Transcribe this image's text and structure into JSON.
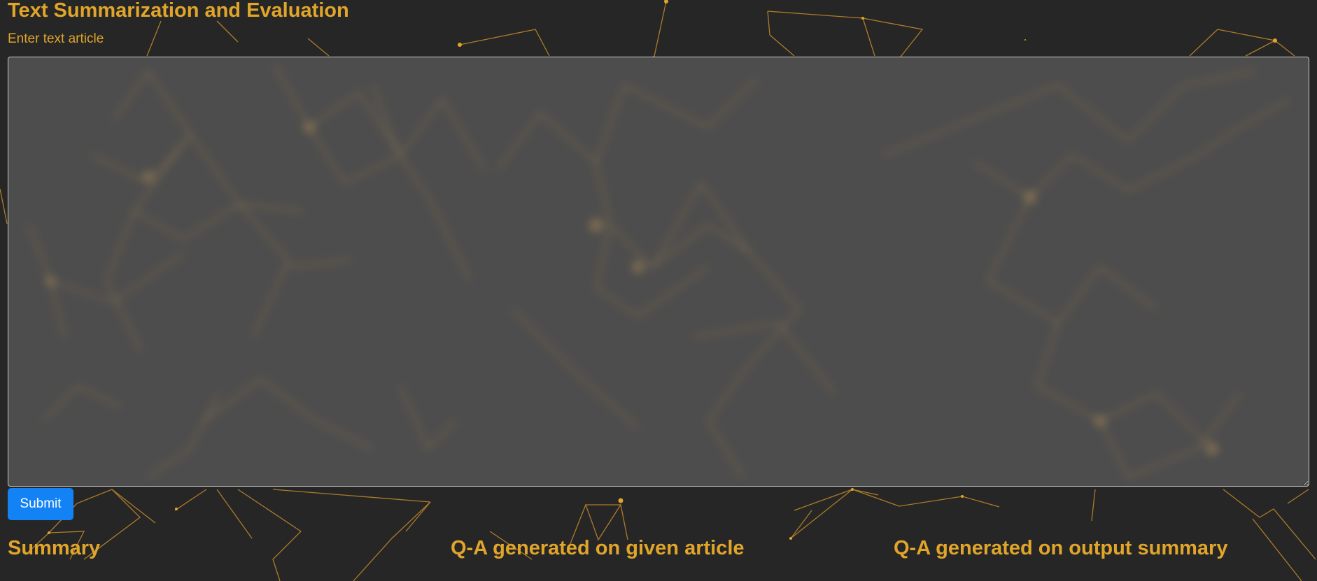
{
  "page": {
    "title": "Text Summarization and Evaluation",
    "article_label": "Enter text article",
    "article_value": "",
    "submit_label": "Submit"
  },
  "sections": {
    "summary_title": "Summary",
    "qa_article_title": "Q-A generated on given article",
    "qa_summary_title": "Q-A generated on output summary"
  },
  "theme": {
    "background": "#262626",
    "accent": "#e0a52a",
    "button": "#1282f5"
  }
}
